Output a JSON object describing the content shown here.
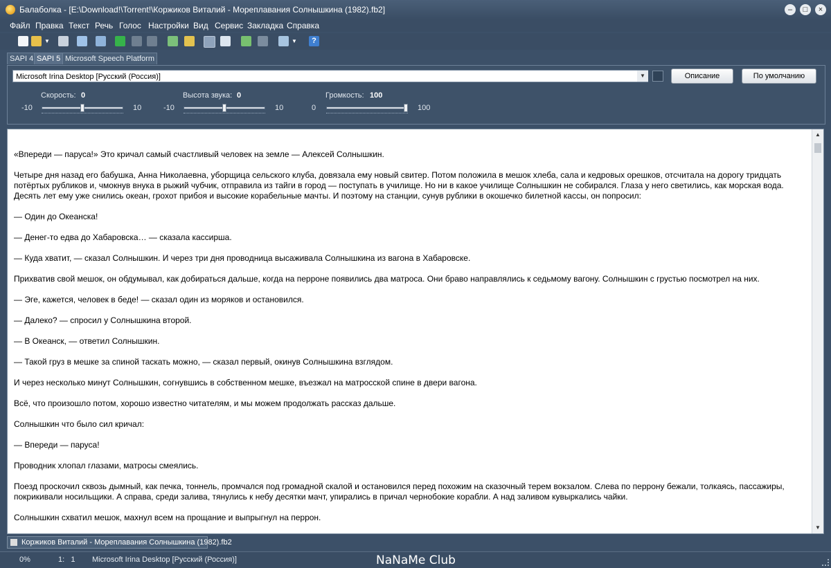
{
  "window": {
    "title": "Балаболка - [E:\\Download!\\Torrent!\\Коржиков Виталий - Мореплавания Солнышкина (1982).fb2]",
    "btn_min": "–",
    "btn_max": "□",
    "btn_close": "×"
  },
  "menu": [
    "Файл",
    "Правка",
    "Текст",
    "Речь",
    "Голос",
    "Настройки",
    "Вид",
    "Сервис",
    "Закладка",
    "Справка"
  ],
  "toolbar_icons": [
    "new-file-icon",
    "open-folder-icon",
    "dropdown-arrow-icon",
    "save-icon",
    "save-audio-icon",
    "export-icon",
    "play-icon",
    "pause-icon",
    "stop-icon",
    "split-icon",
    "batch-icon",
    "clipboard-reader-icon",
    "dictionary-icon",
    "convert-icon",
    "subtitles-icon",
    "file-split-icon",
    "dropdown-arrow-icon",
    "help-icon"
  ],
  "tabs": [
    "SAPI 4",
    "SAPI 5",
    "Microsoft Speech Platform"
  ],
  "voice": {
    "selected": "Microsoft Irina Desktop [Русский (Россия)]",
    "description_button": "Описание",
    "default_button": "По умолчанию"
  },
  "sliders": {
    "speed": {
      "label": "Скорость:",
      "value": "0",
      "min": "-10",
      "max": "10",
      "level": 0.5
    },
    "pitch": {
      "label": "Высота звука:",
      "value": "0",
      "min": "-10",
      "max": "10",
      "level": 0.5
    },
    "volume": {
      "label": "Громкость:",
      "value": "100",
      "min": "0",
      "max": "100",
      "level": 1.0
    }
  },
  "text": {
    "paragraphs": [
      "«Впереди — паруса!» Это кричал самый счастливый человек на земле — Алексей Солнышкин.",
      "Четыре дня назад его бабушка, Анна Николаевна, уборщица сельского клуба, довязала ему новый свитер. Потом положила в мешок хлеба, сала и кедровых орешков, отсчитала на дорогу тридцать потёртых рубликов и, чмокнув внука в рыжий чубчик, отправила из тайги в город — поступать в училище. Но ни в какое училище Солнышкин не собирался. Глаза у него светились, как морская вода. Десять лет ему уже снились океан, грохот прибоя и высокие корабельные мачты. И поэтому на станции, сунув рублики в окошечко билетной кассы, он попросил:",
      "— Один до Океанска!",
      "— Денег-то едва до Хабаровска… — сказала кассирша.",
      "— Куда хватит, — сказал Солнышкин. И через три дня проводница высаживала Солнышкина из вагона в Хабаровске.",
      "Прихватив свой мешок, он обдумывал, как добираться дальше, когда на перроне появились два матроса. Они браво направлялись к седьмому вагону. Солнышкин с грустью посмотрел на них.",
      "— Эге, кажется, человек в беде! — сказал один из моряков и остановился.",
      "— Далеко? — спросил у Солнышкина второй.",
      "— В Океанск, — ответил Солнышкин.",
      "— Такой груз в мешке за спиной таскать можно, — сказал первый, окинув Солнышкина взглядом.",
      "И через несколько минут Солнышкин, согнувшись в собственном мешке, въезжал на матросской спине в двери вагона.",
      "Всё, что произошло потом, хорошо известно читателям, и мы можем продолжать рассказ дальше.",
      "Солнышкин что было сил кричал:",
      "— Впереди — паруса!",
      "Проводник хлопал глазами, матросы смеялись.",
      "Поезд проскочил сквозь дымный, как печка, тоннель, промчался под громадной скалой и остановился перед похожим на сказочный терем вокзалом. Слева по перрону бежали, толкаясь, пассажиры, покрикивали носильщики. А справа, среди залива, тянулись к небу десятки мачт, упирались в причал чернобокие корабли. А над заливом кувыркались чайки.",
      "Солнышкин схватил мешок, махнул всем на прощание и выпрыгнул на перрон."
    ]
  },
  "document_tab": "Коржиков Виталий - Мореплавания Солнышкина (1982).fb2",
  "status": {
    "progress": "0%",
    "position": "1:   1",
    "voice": "Microsoft Irina Desktop [Русский (Россия)]",
    "watermark": "NaNaMe Club"
  }
}
